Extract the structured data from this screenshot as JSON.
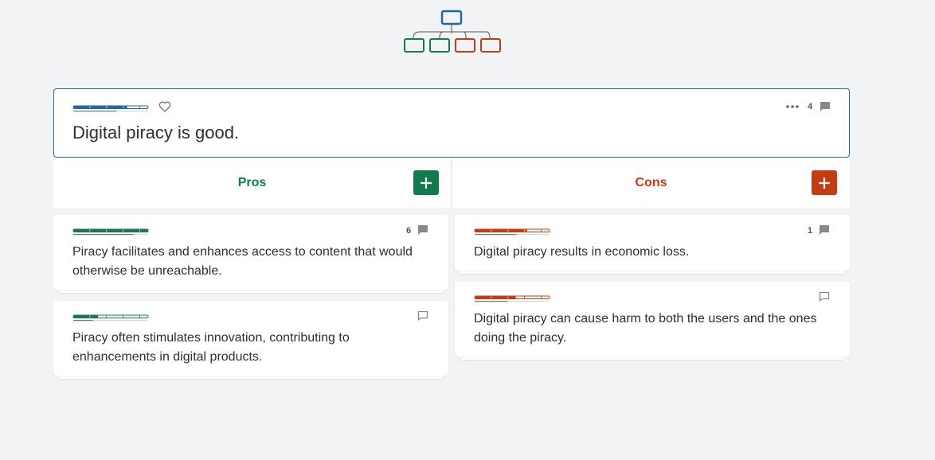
{
  "icons": {
    "tree": "argument-map-icon",
    "heart": "heart-icon",
    "more": "more-dots-icon",
    "comment": "comment-icon",
    "add": "plus-icon"
  },
  "colors": {
    "thesis": "#1f69a8",
    "pro": "#127a4c",
    "con": "#c63b11",
    "background": "#f2f3f5"
  },
  "thesis": {
    "text": "Digital piracy is good.",
    "comment_count": "4",
    "impact_fill": 0.72
  },
  "columns": {
    "pros": {
      "title": "Pros"
    },
    "cons": {
      "title": "Cons"
    }
  },
  "pros": [
    {
      "text": "Piracy facilitates and enhances access to content that would otherwise be unreachable.",
      "comment_count": "6",
      "impact_fill": 1.0
    },
    {
      "text": "Piracy often stimulates innovation, contributing to enhancements in digital products.",
      "comment_count": "",
      "impact_fill": 0.33
    }
  ],
  "cons": [
    {
      "text": "Digital piracy results in economic loss.",
      "comment_count": "1",
      "impact_fill": 0.7
    },
    {
      "text": "Digital piracy can cause harm to both the users and the ones doing the piracy.",
      "comment_count": "",
      "impact_fill": 0.55
    }
  ]
}
